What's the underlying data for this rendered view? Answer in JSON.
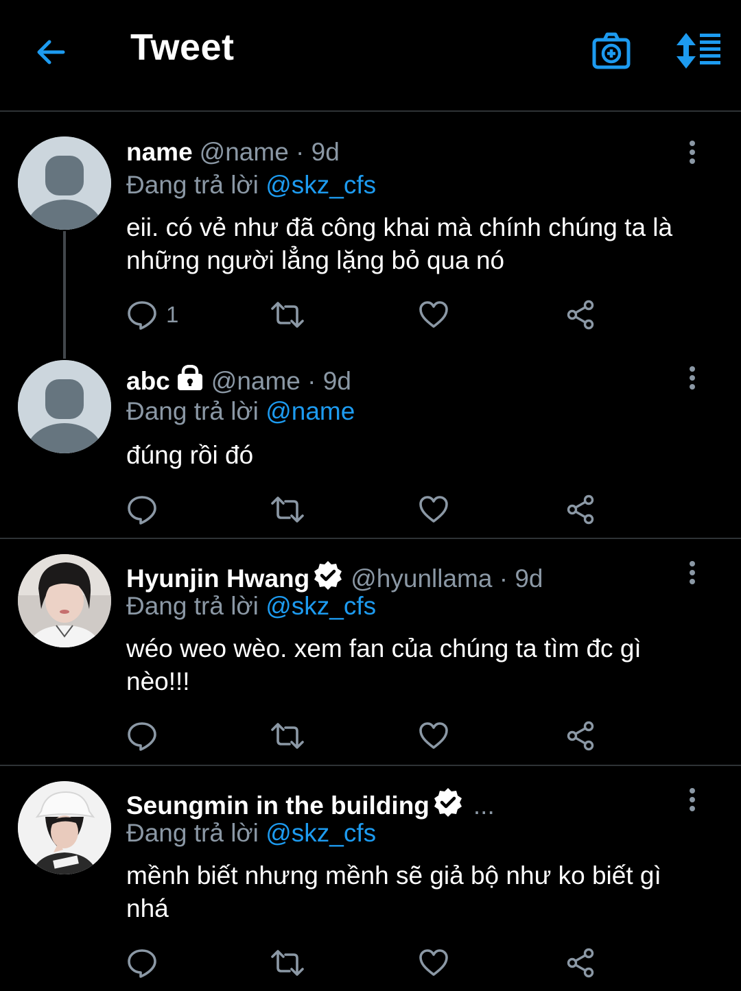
{
  "header": {
    "title": "Tweet",
    "back_icon": "arrow-left-icon",
    "camera_icon": "camera-plus-icon",
    "sort_icon": "sort-list-icon",
    "accent": "#1d9bf0"
  },
  "tweets": [
    {
      "name": "name",
      "handle": "@name · 9d",
      "replying_prefix": "Đang trả lời",
      "replying_to": "@skz_cfs",
      "text": "eii. có vẻ như đã công khai mà chính chúng ta là những người lẳng lặng bỏ qua nó",
      "reply_count": "1",
      "avatar": "default-avatar"
    },
    {
      "name": "abc",
      "handle": "@name · 9d",
      "replying_prefix": "Đang trả lời",
      "replying_to": "@name",
      "text": "đúng rồi đó",
      "reply_count": "",
      "protected": true,
      "avatar": "default-avatar"
    },
    {
      "name": "Hyunjin Hwang",
      "handle": "@hyunllama · 9d",
      "replying_prefix": "Đang trả lời",
      "replying_to": "@skz_cfs",
      "text": "wéo weo wèo. xem fan của chúng ta tìm đc gì nèo!!!",
      "reply_count": "",
      "verified": true,
      "avatar": "photo-avatar"
    },
    {
      "name": "Seungmin in the building",
      "handle": "...",
      "replying_prefix": "Đang trả lời",
      "replying_to": "@skz_cfs",
      "text": "mềnh biết nhưng mềnh sẽ giả bộ như ko biết gì nhá",
      "reply_count": "",
      "verified": true,
      "avatar": "photo-avatar"
    }
  ],
  "colors": {
    "background": "#000000",
    "text_secondary": "#8b98a5",
    "mention": "#1d9bf0",
    "divider": "#2f3336"
  }
}
